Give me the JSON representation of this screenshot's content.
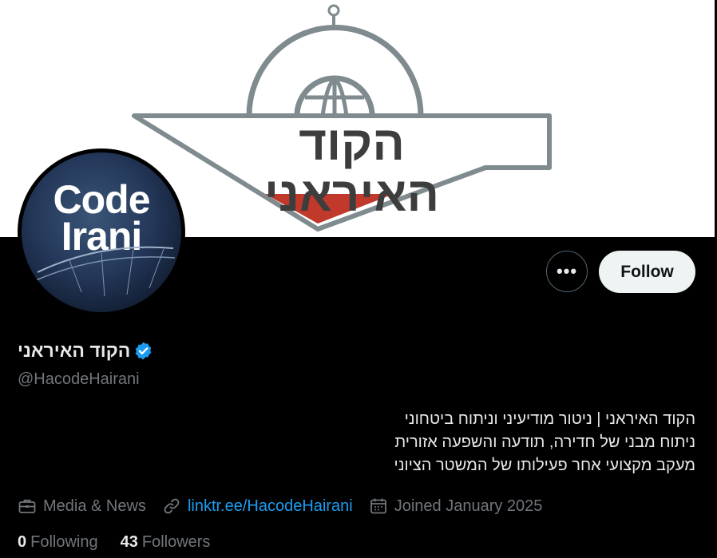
{
  "banner": {
    "logo_text": "הקוד האיראני",
    "colors": {
      "gray": "#7f8b8f",
      "red": "#c0392b",
      "dark": "#3d3d3d"
    }
  },
  "avatar": {
    "line1": "Code",
    "line2": "Irani"
  },
  "actions": {
    "more_label": "•••",
    "follow_label": "Follow"
  },
  "profile": {
    "display_name": "הקוד האיראני",
    "handle": "@HacodeHairani",
    "bio_lines": [
      "הקוד האיראני | ניטור מודיעיני וניתוח ביטחוני",
      "ניתוח מבני של חדירה, תודעה והשפעה אזורית",
      " מעקב מקצועי אחר פעילותו של המשטר הציוני"
    ]
  },
  "meta": {
    "category": "Media & News",
    "link": "linktr.ee/HacodeHairani",
    "joined": "Joined January 2025",
    "icons": [
      "briefcase-icon",
      "link-icon",
      "calendar-icon"
    ]
  },
  "stats": {
    "following_count": "0",
    "following_label": "Following",
    "followers_count": "43",
    "followers_label": "Followers"
  },
  "colors": {
    "accent": "#1d9bf0",
    "muted": "#71767b",
    "verified": "#1d9bf0"
  }
}
